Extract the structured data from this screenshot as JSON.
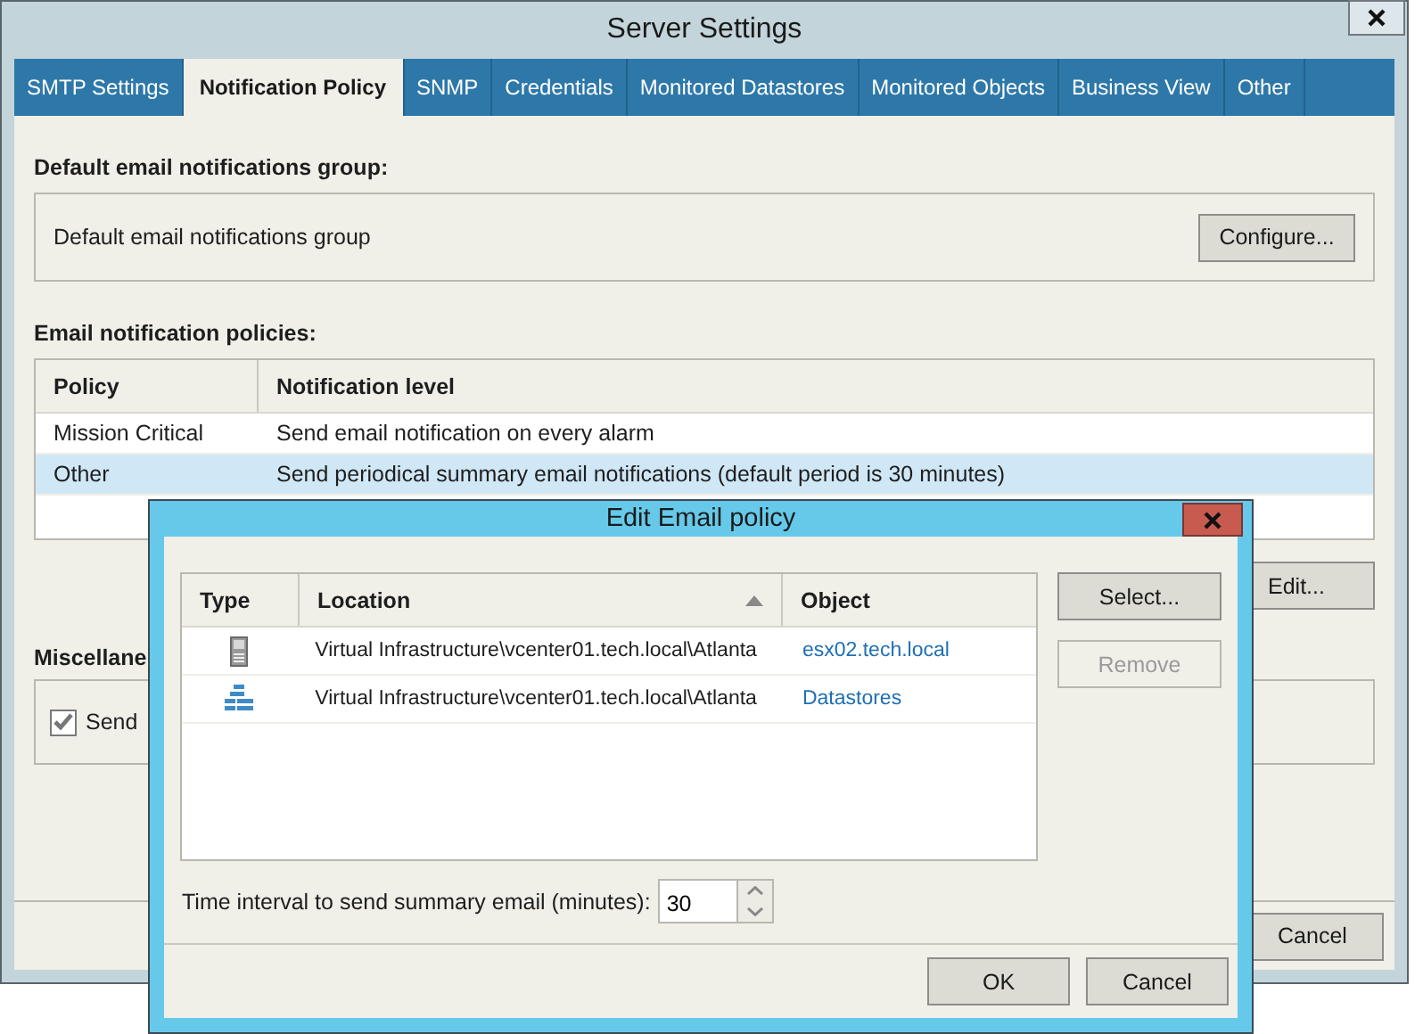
{
  "window": {
    "title": "Server Settings"
  },
  "tabs": [
    {
      "label": "SMTP Settings",
      "selected": false
    },
    {
      "label": "Notification Policy",
      "selected": true
    },
    {
      "label": "SNMP",
      "selected": false
    },
    {
      "label": "Credentials",
      "selected": false
    },
    {
      "label": "Monitored Datastores",
      "selected": false
    },
    {
      "label": "Monitored Objects",
      "selected": false
    },
    {
      "label": "Business View",
      "selected": false
    },
    {
      "label": "Other",
      "selected": false
    }
  ],
  "default_group": {
    "heading": "Default email notifications group:",
    "text": "Default email notifications group",
    "button": "Configure..."
  },
  "policies": {
    "heading": "Email notification policies:",
    "columns": [
      "Policy",
      "Notification level"
    ],
    "rows": [
      {
        "policy": "Mission Critical",
        "level": "Send email notification on every alarm",
        "selected": false
      },
      {
        "policy": "Other",
        "level": "Send periodical summary email notifications (default period is 30 minutes)",
        "selected": true
      }
    ],
    "button": "Edit..."
  },
  "misc": {
    "heading": "Miscellane",
    "checkbox": {
      "label": "Send",
      "checked": true
    }
  },
  "footer_buttons": [
    "Cancel"
  ],
  "dialog": {
    "title": "Edit Email policy",
    "columns": [
      {
        "label": "Type",
        "sorted": false
      },
      {
        "label": "Location",
        "sorted": true
      },
      {
        "label": "Object",
        "sorted": false
      }
    ],
    "rows": [
      {
        "kind": "host",
        "location": "Virtual Infrastructure\\vcenter01.tech.local\\Atlanta",
        "object": "esx02.tech.local"
      },
      {
        "kind": "datastores",
        "location": "Virtual Infrastructure\\vcenter01.tech.local\\Atlanta",
        "object": "Datastores"
      }
    ],
    "buttons": [
      {
        "label": "Select...",
        "disabled": false
      },
      {
        "label": "Remove",
        "disabled": true
      }
    ],
    "interval": {
      "label": "Time interval to send summary email (minutes):",
      "value": "30"
    },
    "footer_buttons": [
      "OK",
      "Cancel"
    ]
  }
}
